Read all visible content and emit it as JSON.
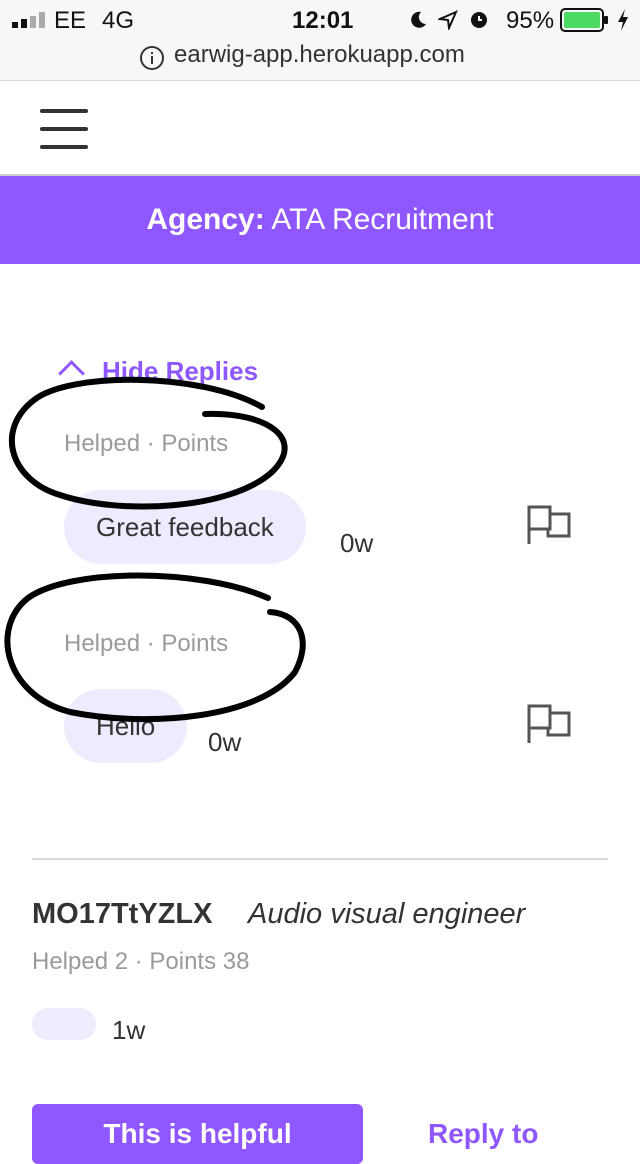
{
  "status_bar": {
    "carrier": "EE",
    "network": "4G",
    "time": "12:01",
    "battery": "95%",
    "icons": [
      "signal-icon",
      "moon-icon",
      "location-icon",
      "alarm-icon",
      "battery-icon",
      "charging-icon"
    ]
  },
  "browser": {
    "url": "earwig-app.herokuapp.com",
    "icon": "info-icon"
  },
  "nav": {
    "icon": "hamburger-menu-icon"
  },
  "agency": {
    "label": "Agency:",
    "name": "ATA Recruitment"
  },
  "colors": {
    "accent": "#8f57ff",
    "bubble": "#efebff",
    "muted": "#9a9a9a"
  },
  "replies": {
    "toggle_label": "Hide Replies",
    "items": [
      {
        "meta": "Helped · Points",
        "text": "Great  feedback",
        "age": "0w"
      },
      {
        "meta": "Helped · Points",
        "text": "Hello",
        "age": "0w"
      }
    ]
  },
  "review": {
    "user_id": "MO17TtYZLX",
    "job_title": "Audio visual engineer",
    "meta": "Helped 2 · Points 38",
    "age": "1w",
    "helpful_button": "This is helpful",
    "link": "Reply to"
  }
}
